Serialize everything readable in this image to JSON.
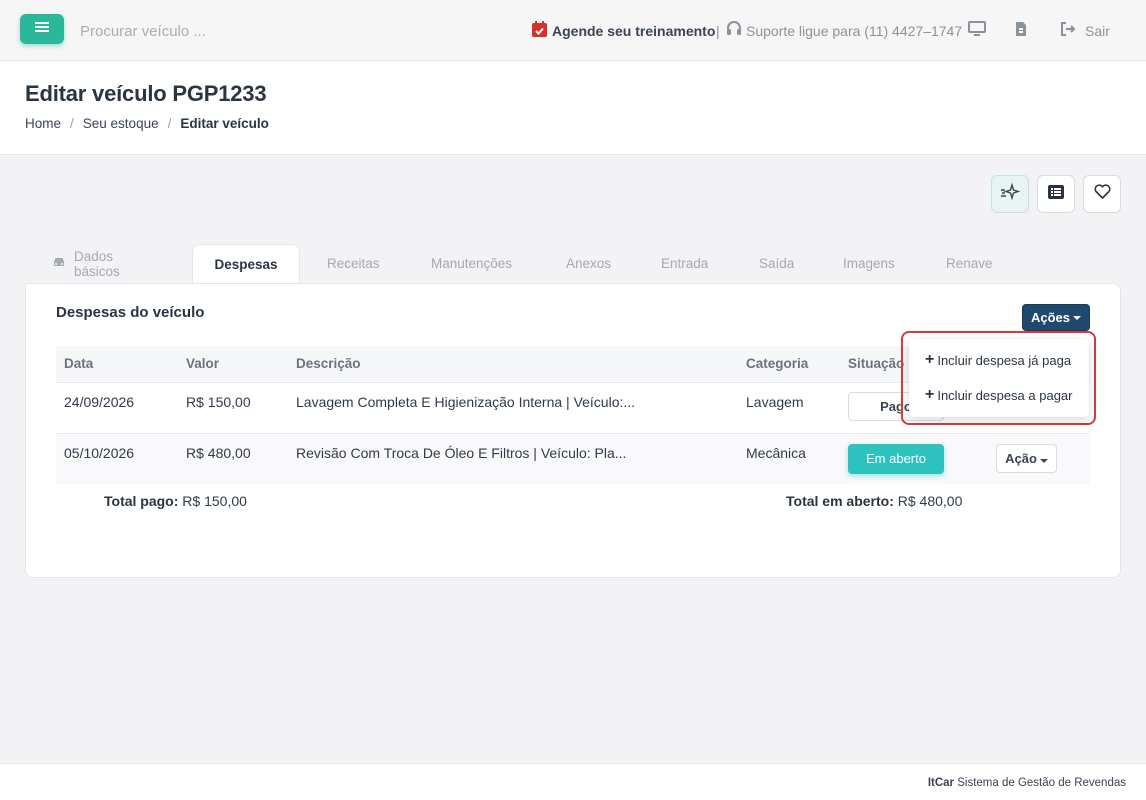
{
  "topbar": {
    "search_placeholder": "Procurar veículo ...",
    "training_label": "Agende seu treinamento",
    "separator": "|",
    "support_label": "Suporte ligue para (11) 4427–1747",
    "logout_label": "Sair",
    "icons": [
      "menu-icon",
      "calendar-check-icon",
      "headset-icon",
      "monitor-icon",
      "document-icon",
      "logout-icon"
    ]
  },
  "header": {
    "title": "Editar veículo PGP1233",
    "breadcrumb": [
      "Home",
      "Seu estoque",
      "Editar veículo"
    ],
    "breadcrumb_separator": "/"
  },
  "actions": {
    "icons": [
      "ai-sparkle-icon",
      "list-icon",
      "heart-icon"
    ]
  },
  "tabs": [
    {
      "label": "Dados básicos",
      "icon": "car-icon"
    },
    {
      "label": "Despesas",
      "active": true
    },
    {
      "label": "Receitas"
    },
    {
      "label": "Manutenções"
    },
    {
      "label": "Anexos"
    },
    {
      "label": "Entrada"
    },
    {
      "label": "Saída"
    },
    {
      "label": "Imagens"
    },
    {
      "label": "Renave"
    }
  ],
  "card": {
    "title": "Despesas do veículo",
    "actions_button": "Ações",
    "columns": [
      "Data",
      "Valor",
      "Descrição",
      "Categoria",
      "Situação"
    ],
    "rows": [
      {
        "date": "24/09/2026",
        "value": "R$ 150,00",
        "description": "Lavagem Completa E Higienização Interna | Veículo:...",
        "category": "Lavagem",
        "status": "Pago"
      },
      {
        "date": "05/10/2026",
        "value": "R$ 480,00",
        "description": "Revisão Com Troca De Óleo E Filtros | Veículo: Pla...",
        "category": "Mecânica",
        "status": "Em aberto",
        "action": "Ação"
      }
    ],
    "total_paid_label": "Total pago:",
    "total_paid_value": "R$ 150,00",
    "total_open_label": "Total em aberto:",
    "total_open_value": "R$ 480,00"
  },
  "dropdown": {
    "items": [
      "Incluir despesa já paga",
      "Incluir despesa a pagar"
    ],
    "plus": "+"
  },
  "footer": {
    "brand": "ItCar",
    "text": "Sistema de Gestão de Revendas"
  },
  "colors": {
    "primary_green": "#2bb89a",
    "dark_blue": "#1f4a6e",
    "teal": "#2ec2bf",
    "highlight_red": "#d23c3c"
  }
}
